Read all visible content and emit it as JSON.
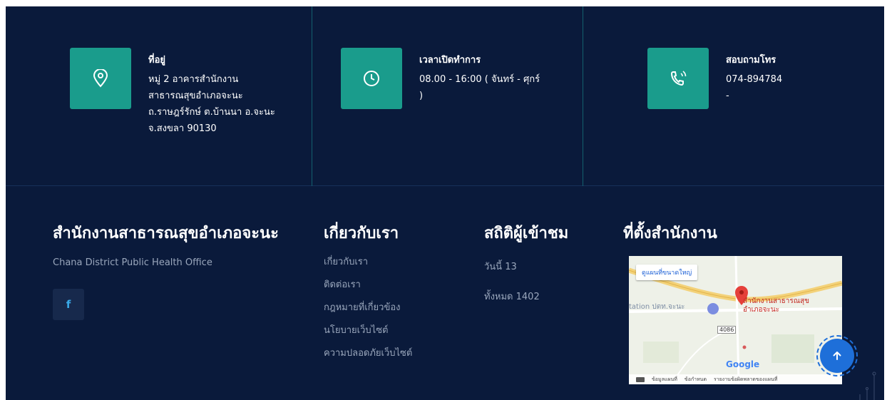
{
  "contact": {
    "address": {
      "title": "ที่อยู่",
      "lines": [
        "หมู่ 2 อาคารสำนักงาน",
        "สาธารณสุขอำเภอจะนะ",
        "ถ.ราษฎร์รักษ์ ต.บ้านนา อ.จะนะ",
        "จ.สงขลา 90130"
      ]
    },
    "hours": {
      "title": "เวลาเปิดทำการ",
      "lines": [
        "08.00 - 16:00 ( จันทร์ - ศุกร์",
        ")"
      ]
    },
    "phone": {
      "title": "สอบถามโทร",
      "lines": [
        "074-894784",
        "-"
      ]
    }
  },
  "about": {
    "title": "สำนักงานสาธารณสุขอำเภอจะนะ",
    "subtitle": "Chana District Public Health Office",
    "facebook_label": "f"
  },
  "links": {
    "title": "เกี่ยวกับเรา",
    "items": [
      "เกี่ยวกับเรา",
      "ติดต่อเรา",
      "กฎหมายที่เกี่ยวข้อง",
      "นโยบายเว็บไซต์",
      "ความปลอดภัยเว็บไซต์"
    ]
  },
  "stats": {
    "title": "สถิติผู้เข้าชม",
    "today": "วันนี้ 13",
    "total": "ทั้งหมด 1402"
  },
  "location": {
    "title": "ที่ตั้งสำนักงาน",
    "map_button": "ดูแผนที่ขนาดใหญ่",
    "place_line1": "สำนักงานสาธารณสุข",
    "place_line2": "อำเภอจะนะ",
    "left_label": "tation ปตท.จะนะ",
    "road": "4086",
    "google": "Google",
    "footer_links": [
      "ข้อมูลแผนที่",
      "ข้อกำหนด",
      "รายงานข้อผิดพลาดของแผนที่"
    ]
  },
  "icons": {
    "location": "map-pin-icon",
    "clock": "clock-icon",
    "phone": "phone-icon",
    "back_to_top": "arrow-up-icon"
  },
  "colors": {
    "background": "#0a1a3b",
    "icon_box": "#1a9c8c",
    "accent_button": "#1e6fd9",
    "facebook": "#39a8e6"
  }
}
